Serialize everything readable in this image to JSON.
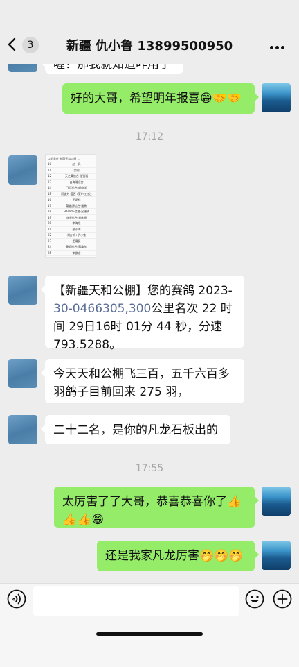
{
  "header": {
    "back_count": "3",
    "title": "新疆 仇小鲁 13899500950"
  },
  "messages": [
    {
      "text": "喔！那我就知道咋用了"
    },
    {
      "text": "好的大哥，希望明年报喜😁🤝🤝"
    },
    {
      "time": "17:12"
    },
    {
      "image": {
        "title": "以前条件 新疆天和公棚 ...",
        "rows": [
          [
            "10",
            "赵一兵"
          ],
          [
            "11",
            "梁明"
          ],
          [
            "12",
            "天之翼信合·张强福"
          ],
          [
            "13",
            "白海湘远舍"
          ],
          [
            "14",
            "飞洋信合·朗旅洋"
          ],
          [
            "15",
            "阿波力·塔西+莱尔江红江"
          ],
          [
            "16",
            "王炳祥"
          ],
          [
            "17",
            "疆鑫源信合·潘勇"
          ],
          [
            "18",
            "HAIWYE信合·吕德明"
          ],
          [
            "19",
            "庆贤信合·刘庆贤"
          ],
          [
            "20",
            "李海东"
          ],
          [
            "21",
            "张小海"
          ],
          [
            "22",
            "刘方新+仇小鲁"
          ],
          [
            "23",
            "孟建民"
          ],
          [
            "24",
            "鹏翔信合·蒋鑫东"
          ],
          [
            "25",
            "李俊宏"
          ],
          [
            "26",
            "阿不拉米提·多里甫"
          ],
          [
            "27",
            "尔巴拉苗"
          ]
        ]
      }
    },
    {
      "parts": [
        "【新疆天和公棚】您的赛鸽 2023-",
        "30-0466305,300",
        "公里名次 22 时间 29日16时 01分 44 秒，分速 793.5288。"
      ]
    },
    {
      "text": "今天天和公棚飞三百，五千六百多羽鸽子目前回来 275 羽，"
    },
    {
      "text": "二十二名，是你的凡龙石板出的"
    },
    {
      "time": "17:55"
    },
    {
      "text": "太厉害了了大哥，恭喜恭喜你了👍👍👍😁"
    },
    {
      "text": "还是我家凡龙厉害🤭🤭🤭"
    }
  ],
  "input": {
    "value": ""
  },
  "colors": {
    "bg": "#ededed",
    "mine": "#95ec69",
    "theirs": "#ffffff",
    "link": "#5a6d96"
  }
}
